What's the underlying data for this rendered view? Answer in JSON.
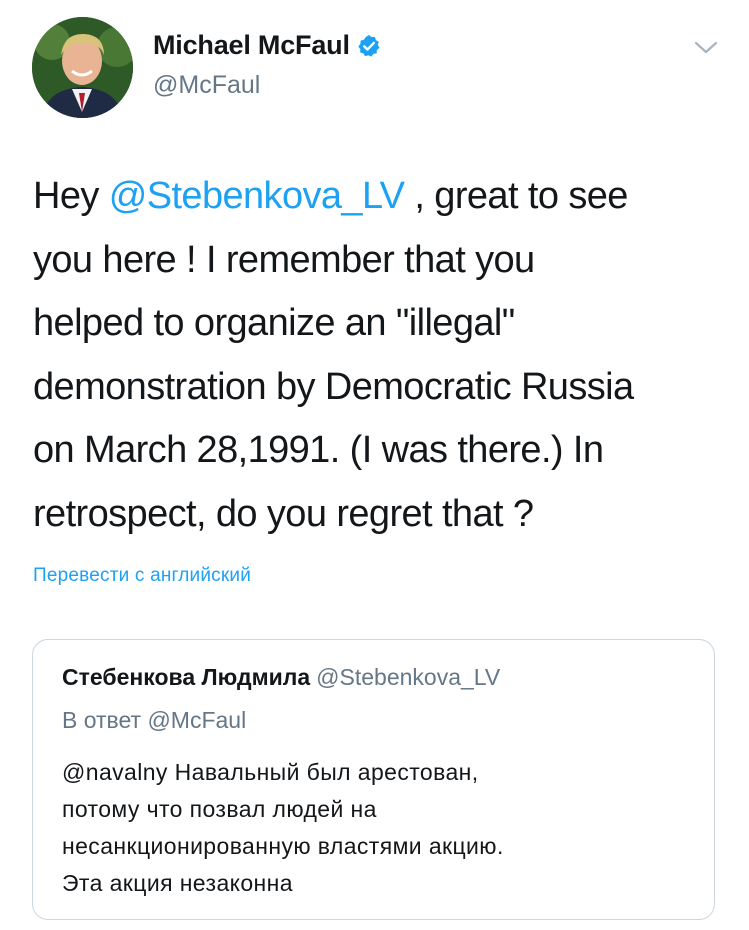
{
  "author": {
    "display_name": "Michael McFaul",
    "handle": "@McFaul",
    "verified": true,
    "avatar_icon": "profile-photo",
    "verified_icon": "verified-badge-icon",
    "menu_icon": "chevron-down-icon"
  },
  "tweet": {
    "lines": [
      {
        "before": "Hey ",
        "mention": "@Stebenkova_LV",
        "after": " , great to see"
      },
      {
        "text": "you here !  I remember that you"
      },
      {
        "text": "helped to organize an \"illegal\""
      },
      {
        "text": "demonstration by Democratic Russia"
      },
      {
        "text": "on March 28,1991. (I was there.) In"
      },
      {
        "text": "retrospect, do you regret that ?"
      }
    ],
    "translate_link": "Перевести с английский"
  },
  "quoted": {
    "display_name": "Стебенкова Людмила",
    "handle": "@Stebenkova_LV",
    "reply_to": "В ответ @McFaul",
    "lines": [
      "@navalny Навальный был арестован,",
      "потому что позвал людей на",
      "несанкционированную властями акцию.",
      "Эта акция незаконна"
    ]
  },
  "colors": {
    "accent": "#1da1f2",
    "text": "#14171a",
    "secondary": "#657786",
    "border": "#cdd6dd"
  }
}
